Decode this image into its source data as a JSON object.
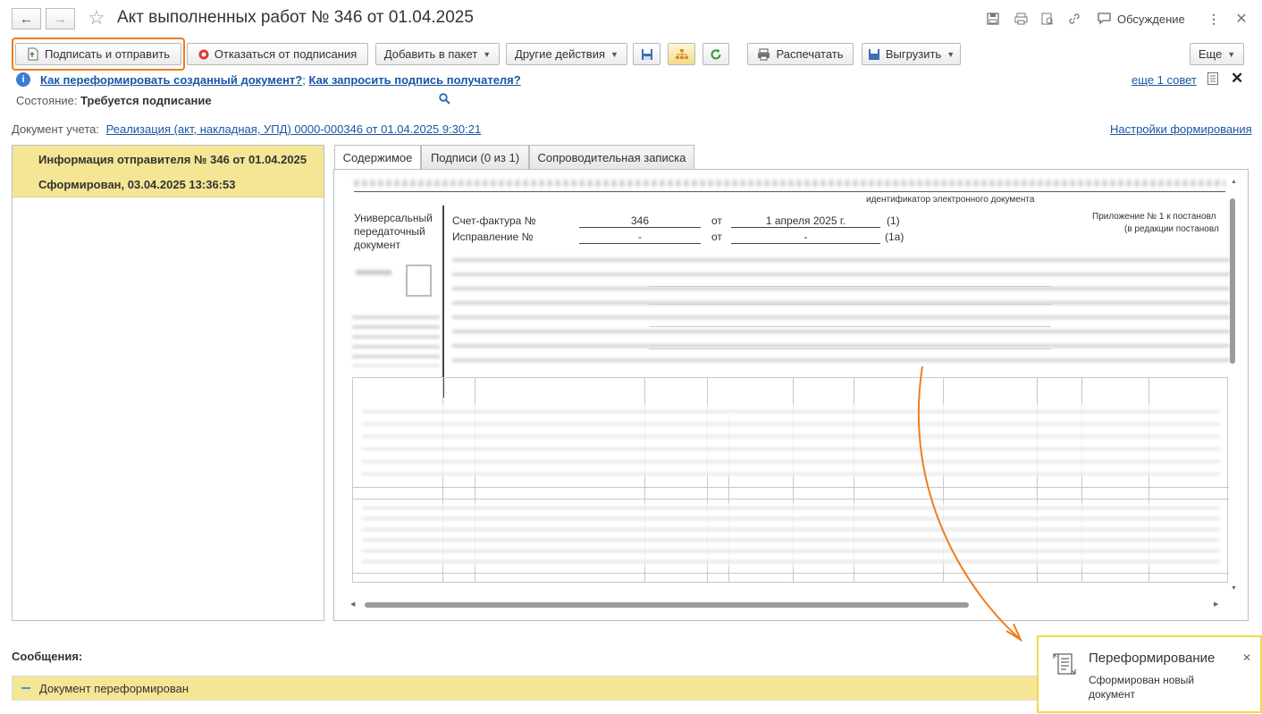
{
  "window": {
    "title": "Акт выполненных работ № 346 от 01.04.2025",
    "discuss_label": "Обсуждение"
  },
  "toolbar": {
    "sign_send": "Подписать и отправить",
    "refuse_sign": "Отказаться от подписания",
    "add_package": "Добавить в пакет",
    "other_actions": "Другие действия",
    "print": "Распечатать",
    "export": "Выгрузить",
    "more": "Еще"
  },
  "hints": {
    "link1": "Как переформировать созданный документ?",
    "separator": ";",
    "link2": "Как запросить подпись получателя?",
    "more_tip": "еще 1 совет"
  },
  "state": {
    "label": "Состояние:",
    "value": "Требуется подписание"
  },
  "accounting_doc": {
    "label": "Документ учета:",
    "link": "Реализация (акт, накладная, УПД) 0000-000346 от 01.04.2025 9:30:21",
    "settings_link": "Настройки формирования"
  },
  "left_panel": {
    "items": [
      "Информация отправителя № 346 от 01.04.2025",
      "Сформирован, 03.04.2025 13:36:53"
    ]
  },
  "tabs": [
    {
      "label": "Содержимое",
      "active": true
    },
    {
      "label": "Подписи (0 из 1)",
      "active": false
    },
    {
      "label": "Сопроводительная записка",
      "active": false
    }
  ],
  "document": {
    "electronic_id_caption": "идентификатор электронного документа",
    "upd_title_1": "Универсальный",
    "upd_title_2": "передаточный",
    "upd_title_3": "документ",
    "invoice_label": "Счет-фактура №",
    "invoice_number": "346",
    "from_1": "от",
    "invoice_date": "1 апреля 2025 г.",
    "code_1": "(1)",
    "correction_label": "Исправление №",
    "correction_number": "-",
    "from_2": "от",
    "correction_date": "-",
    "code_1a": "(1а)",
    "appendix_1": "Приложение № 1 к постановл",
    "appendix_2": "(в редакции постановл"
  },
  "messages": {
    "heading": "Сообщения:",
    "item": "Документ переформирован"
  },
  "notification": {
    "title": "Переформирование",
    "body_1": "Сформирован новый",
    "body_2": "документ"
  },
  "colors": {
    "accent_orange": "#f07d1a",
    "highlight_yellow": "#f5e696",
    "link_blue": "#1a56a5"
  }
}
